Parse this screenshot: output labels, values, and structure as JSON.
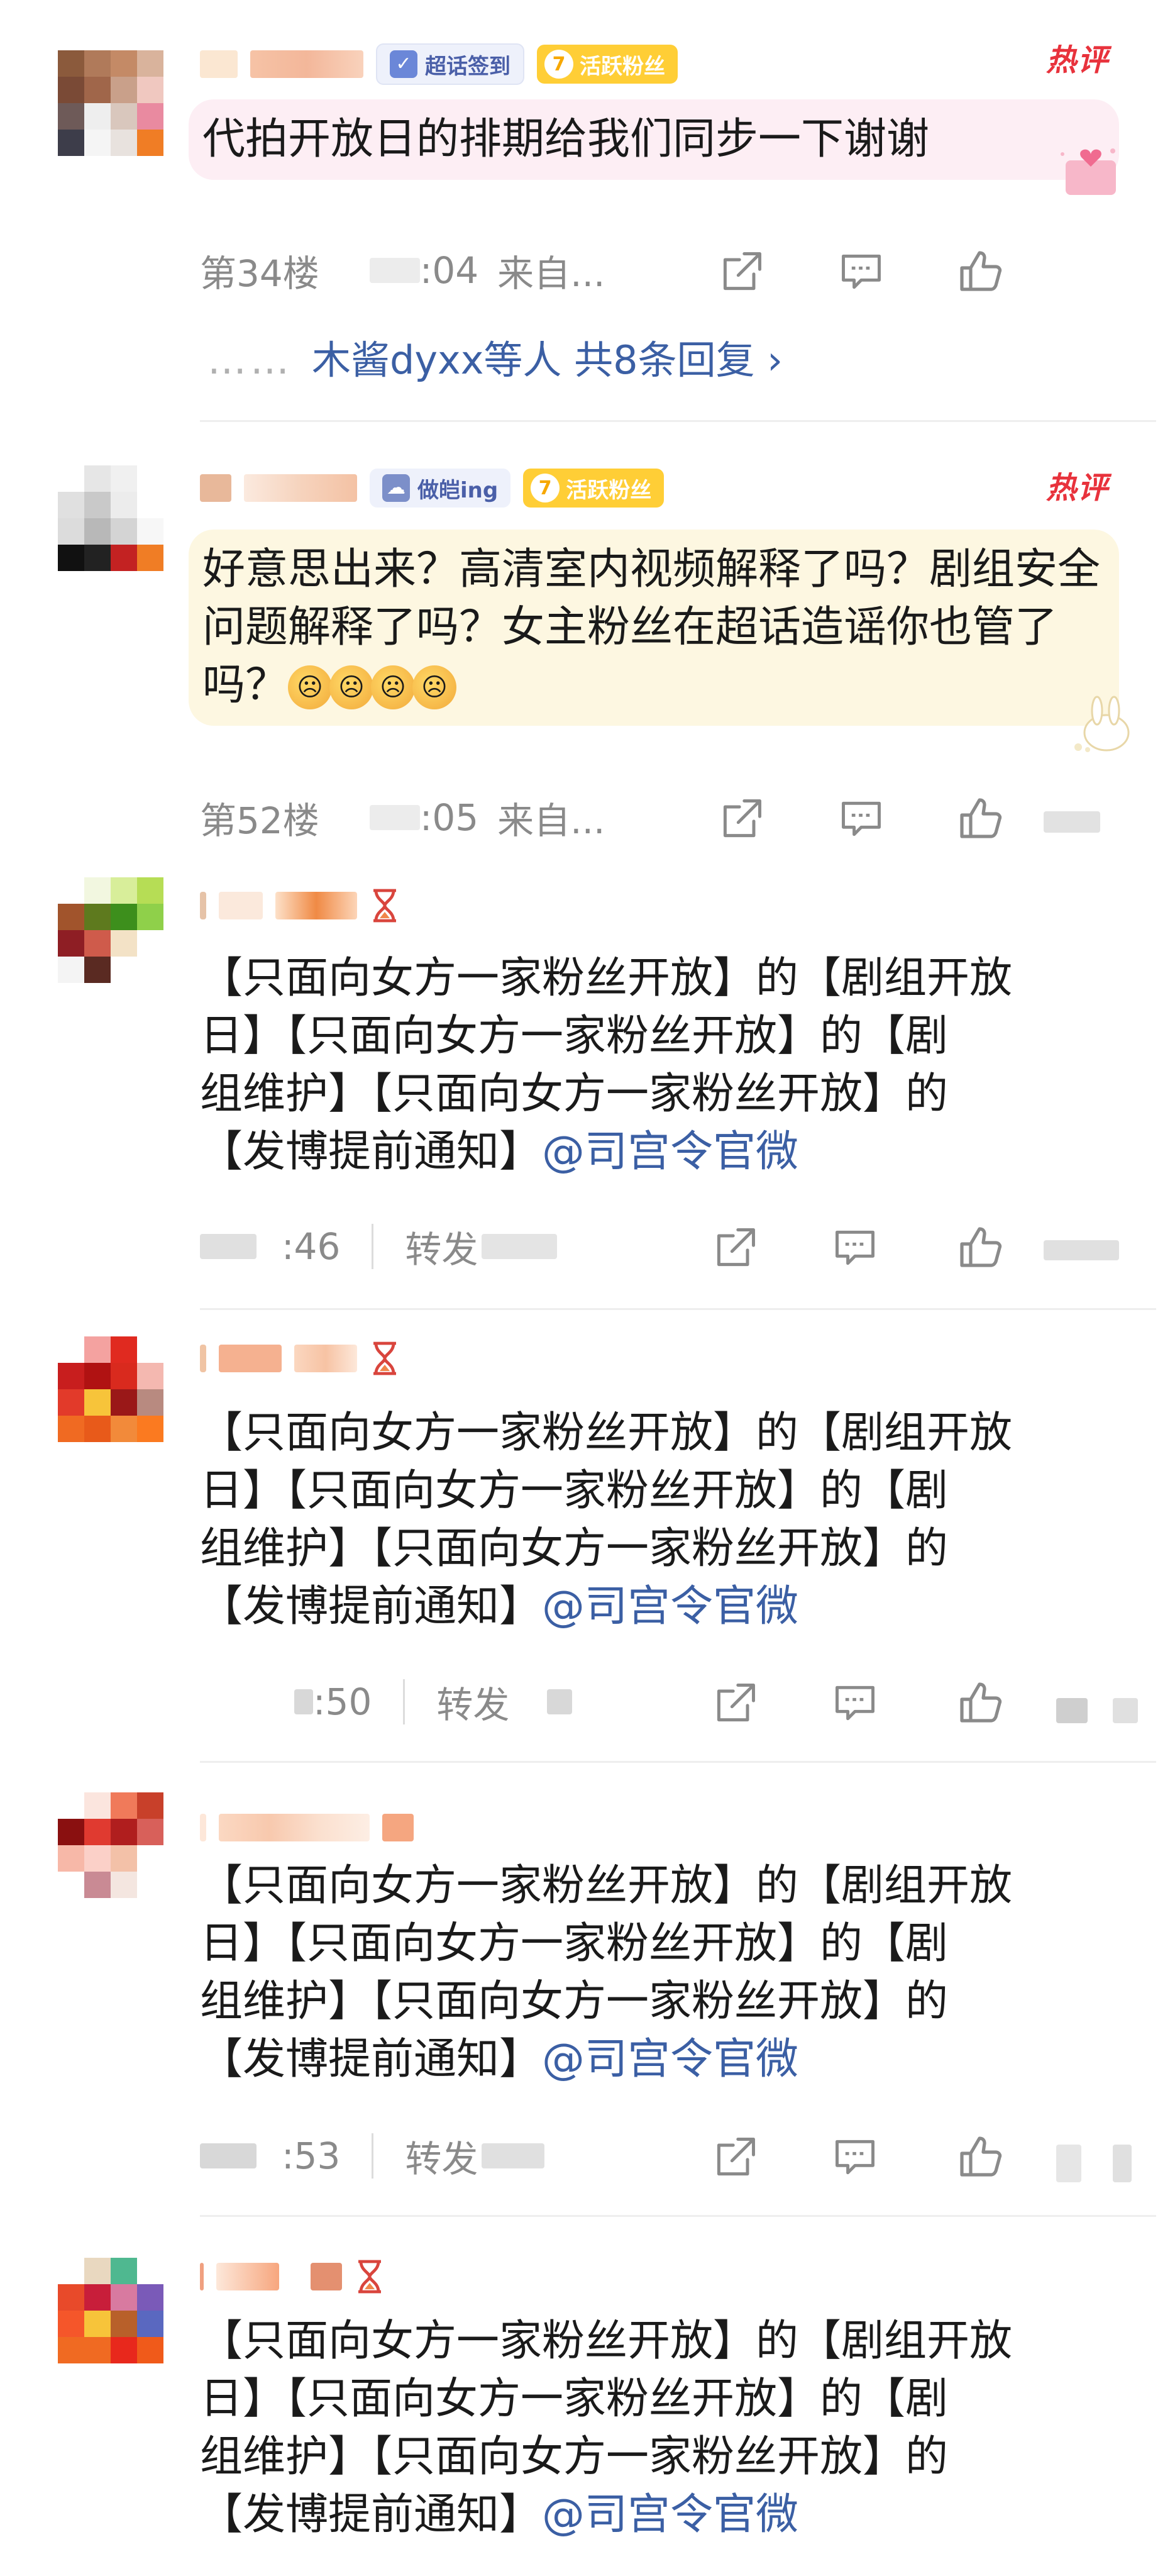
{
  "colors": {
    "link": "#3b5fa4",
    "hot": "#e8323c",
    "meta": "#8a8a8a",
    "badge_gold": "#ffce36"
  },
  "comments": [
    {
      "badges": {
        "sign": "超话签到",
        "active_level": "7",
        "active": "活跃粉丝"
      },
      "hot_label": "热评",
      "text": "代拍开放日的排期给我们同步一下谢谢",
      "floor": "第34楼",
      "time": ":04",
      "source": "来自...",
      "replies": {
        "dots": "……",
        "text": "木酱dyxx等人 共8条回复 ›"
      }
    },
    {
      "badges": {
        "ing": "做皑ing",
        "active_level": "7",
        "active": "活跃粉丝"
      },
      "hot_label": "热评",
      "text": "好意思出来？高清室内视频解释了吗？剧组安全问题解释了吗？女主粉丝在超话造谣你也管了吗？",
      "floor": "第52楼",
      "time": ":05",
      "source": "来自..."
    },
    {
      "text_line1": "【只面向女方一家粉丝开放】的【剧组开放",
      "text_line2": "日】【只面向女方一家粉丝开放】的【剧",
      "text_line3": "组维护】【只面向女方一家粉丝开放】的",
      "text_line4": "【发博提前通知】",
      "mention": "@司宫令官微",
      "time": ":46",
      "repost": "转发"
    },
    {
      "text_line1": "【只面向女方一家粉丝开放】的【剧组开放",
      "text_line2": "日】【只面向女方一家粉丝开放】的【剧",
      "text_line3": "组维护】【只面向女方一家粉丝开放】的",
      "text_line4": "【发博提前通知】",
      "mention": "@司宫令官微",
      "time": ":50",
      "repost": "转发"
    },
    {
      "text_line1": "【只面向女方一家粉丝开放】的【剧组开放",
      "text_line2": "日】【只面向女方一家粉丝开放】的【剧",
      "text_line3": "组维护】【只面向女方一家粉丝开放】的",
      "text_line4": "【发博提前通知】",
      "mention": "@司宫令官微",
      "time": ":53",
      "repost": "转发"
    },
    {
      "text_line1": "【只面向女方一家粉丝开放】的【剧组开放",
      "text_line2": "日】【只面向女方一家粉丝开放】的【剧",
      "text_line3": "组维护】【只面向女方一家粉丝开放】的",
      "text_line4": "【发博提前通知】",
      "mention": "@司宫令官微"
    }
  ]
}
